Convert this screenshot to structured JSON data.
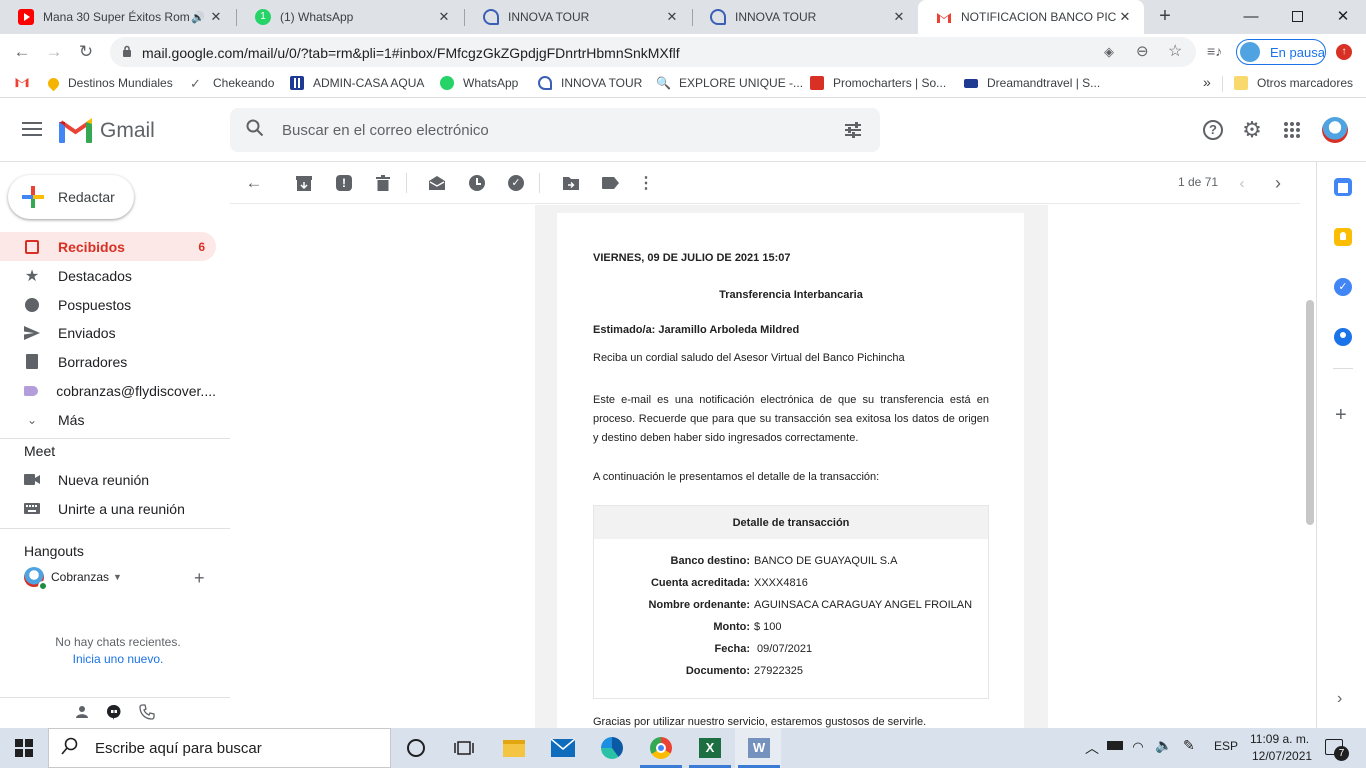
{
  "browser": {
    "tabs": [
      {
        "title": "Mana 30 Super Éxitos Rom",
        "icon": "youtube-icon",
        "color": "#ff0000"
      },
      {
        "title": "(1) WhatsApp",
        "icon": "whatsapp-icon",
        "color": "#25d366"
      },
      {
        "title": "INNOVA TOUR",
        "icon": "innova-tour-icon",
        "color": "#3b5fb5"
      },
      {
        "title": "INNOVA TOUR",
        "icon": "innova-tour-icon",
        "color": "#3b5fb5"
      },
      {
        "title": "NOTIFICACION BANCO PICHIN",
        "icon": "gmail-icon",
        "color": "#ea4335"
      }
    ],
    "url": "mail.google.com/mail/u/0/?tab=rm&pli=1#inbox/FMfcgzGkZGpdjgFDnrtrHbmnSnkMXflf",
    "profile_status": "En pausa",
    "bookmarks": [
      {
        "label": "",
        "icon": "gmail-icon"
      },
      {
        "label": "Destinos Mundiales"
      },
      {
        "label": "Chekeando"
      },
      {
        "label": "ADMIN-CASA AQUA"
      },
      {
        "label": "WhatsApp"
      },
      {
        "label": "INNOVA TOUR"
      },
      {
        "label": "EXPLORE UNIQUE -..."
      },
      {
        "label": "Promocharters | So..."
      },
      {
        "label": "Dreamandtravel | S..."
      }
    ],
    "other_bookmarks": "Otros marcadores",
    "overflow": "»"
  },
  "gmail": {
    "logo_text": "Gmail",
    "search_placeholder": "Buscar en el correo electrónico",
    "compose": "Redactar",
    "nav": [
      {
        "label": "Recibidos",
        "count": "6"
      },
      {
        "label": "Destacados"
      },
      {
        "label": "Pospuestos"
      },
      {
        "label": "Enviados"
      },
      {
        "label": "Borradores"
      },
      {
        "label": "cobranzas@flydiscover...."
      },
      {
        "label": "Más"
      }
    ],
    "meet": {
      "title": "Meet",
      "items": [
        "Nueva reunión",
        "Unirte a una reunión"
      ]
    },
    "hangouts": {
      "title": "Hangouts",
      "user": "Cobranzas",
      "empty": "No hay chats recientes.",
      "start": "Inicia uno nuevo."
    },
    "pager": "1 de 71"
  },
  "email": {
    "date": "VIERNES, 09 DE JULIO DE 2021 15:07",
    "title": "Transferencia Interbancaria",
    "greeting": "Estimado/a: Jaramillo Arboleda Mildred",
    "intro": "Reciba un cordial saludo del Asesor Virtual del Banco Pichincha",
    "body": "Este e-mail es una notificación electrónica de que su transferencia está en proceso.  Recuerde que para que su transacción sea exitosa los datos de origen y destino deben haber sido ingresados correctamente.",
    "detail_intro": "A continuación le presentamos el detalle de la transacción:",
    "detail_title": "Detalle de transacción",
    "details": [
      {
        "key": "Banco destino:",
        "value": "BANCO DE GUAYAQUIL S.A"
      },
      {
        "key": "Cuenta acreditada:",
        "value": "XXXX4816"
      },
      {
        "key": "Nombre ordenante:",
        "value": "AGUINSACA CARAGUAY ANGEL FROILAN"
      },
      {
        "key": "Monto:",
        "value": "$ 100"
      },
      {
        "key": "Fecha:",
        "value": " 09/07/2021"
      },
      {
        "key": "Documento:",
        "value": "27922325"
      }
    ],
    "closing": "Gracias por utilizar nuestro servicio, estaremos gustosos de servirle."
  },
  "taskbar": {
    "search_placeholder": "Escribe aquí para buscar",
    "lang": "ESP",
    "time": "11:09 a. m.",
    "date": "12/07/2021",
    "notifications": "7"
  },
  "colors": {
    "gmail_red": "#d93025",
    "accent_blue": "#1a73e8"
  }
}
